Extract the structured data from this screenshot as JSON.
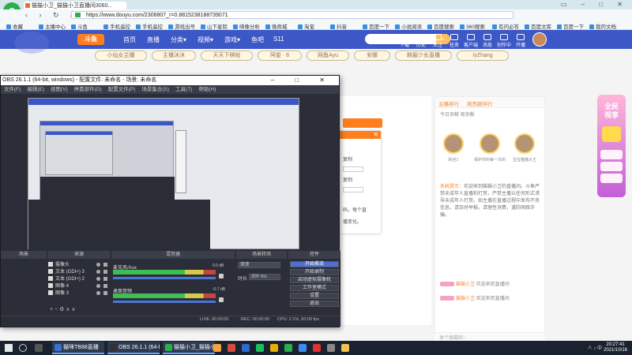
{
  "browser": {
    "logo": "e",
    "active_tab": "猫猫小卫_猫猫小卫直播间3060...",
    "tabs": [
      "猫猫小卫_猫猫小卫直播间3060...",
      "",
      "",
      ""
    ],
    "url": "https://www.douyu.com/2306807_r=0.8815238188739071",
    "nav": "‹ › ↻ ⌂",
    "window_controls": "▭ – □ ✕",
    "bookmarks": [
      "收藏",
      "主播中心",
      "斗鱼",
      "手机遥控",
      "手机遥控",
      "游戏出号",
      "山下星际",
      "映像分析",
      "微商城",
      "淘宝",
      "抖音",
      "百度一下",
      "小说阅读",
      "百度搜索",
      "360搜索",
      "有问必答",
      "百度文库",
      "百度一下",
      "我的文档"
    ]
  },
  "site": {
    "logo": "斗鱼",
    "menu": [
      "首页",
      "直播",
      "分类▾",
      "视频▾",
      "游戏▾",
      "鱼吧",
      "S11"
    ],
    "search_icon": "search-icon",
    "search_btn": "⌕",
    "tools": [
      "下载",
      "历史",
      "关注",
      "任务",
      "客户端",
      "消息",
      "创作中心",
      "开播"
    ],
    "hot_tags": [
      "小仙女主播",
      "主播沐沐",
      "天天下棋帖",
      "阿俊 · 8",
      "网鱼Ayu",
      "安娜",
      "韩服少女直播",
      "/yZhang"
    ]
  },
  "popup": {
    "close": "✕",
    "lines": [
      "复制",
      "复制",
      "码，每个直",
      "播变化。"
    ]
  },
  "panel": {
    "tabs": [
      "主播排行",
      "周贡献排行"
    ],
    "sub": "今日贡献     周贡献",
    "fans": [
      "粉丝1",
      "保护你的每一次的",
      "宝宝猫猫大王"
    ],
    "notice_prefix": "系统提示：",
    "notice": "欢迎来到猫猫小卫的直播间。斗鱼严禁未成年人直播和打赏，严禁主播以任何形式诱导未成年人打赏。如主播在直播过程中发布不良信息，请及时举报。请理性消费，谨防网络诈骗。",
    "joins": [
      {
        "lv": "",
        "who": "猫猫小卫",
        "text": "欢迎来到直播间"
      },
      {
        "lv": "",
        "who": "猫猫小卫",
        "text": "欢迎来到直播间"
      }
    ],
    "chat_hint": "发个弹幕呗~"
  },
  "ad": {
    "text": "全民\n视享"
  },
  "obs": {
    "title": "OBS 26.1.1 (64-bit, windows) - 配置文件: 未命名 - 场景: 未命名",
    "window_controls": "– □ ✕",
    "menu": [
      "文件(F)",
      "编辑(E)",
      "视图(V)",
      "停靠部件(D)",
      "配置文件(P)",
      "场景集合(S)",
      "工具(T)",
      "帮助(H)"
    ],
    "docks": [
      "场景",
      "来源",
      "混音器",
      "场景转场",
      "控件"
    ],
    "sources": [
      "摄像头",
      "文本 (GDI+) 3",
      "文本 (GDI+) 2",
      "图像 4",
      "图像 3"
    ],
    "mixer": [
      {
        "label": "麦克风/Aux",
        "level": "0.0 dB"
      },
      {
        "label": "桌面音频",
        "level": "-0.7 dB"
      }
    ],
    "transition_label": "时长",
    "transition_value": "渐变",
    "duration": "300 ms",
    "controls": [
      "开始推流",
      "开始录制",
      "启动虚拟摄像机",
      "工作室模式",
      "设置",
      "退出"
    ],
    "status": [
      "LIVE: 00:00:00",
      "REC: 00:00:00",
      "CPU: 2.1%, 60.00 fps"
    ],
    "toolbar": "+ − ⚙ ∧ ∨"
  },
  "taskbar": {
    "apps": [
      {
        "label": "猫咪TB88直播",
        "color": "#3c6fd8"
      },
      {
        "label": "OBS 26.1.1 (64-bit...",
        "color": "#333"
      },
      {
        "label": "猫猫小卫_猫猫小卫...",
        "color": "#2cae4a"
      }
    ],
    "time": "20:27:41",
    "date": "2021/10/16",
    "tray": "∧ ♪ 中"
  }
}
